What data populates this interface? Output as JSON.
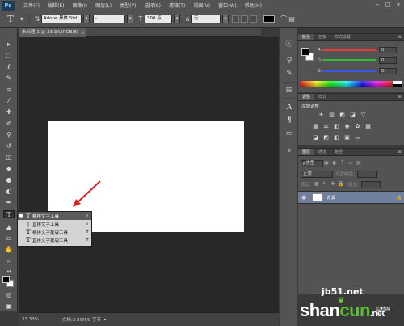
{
  "app": {
    "logo": "Ps",
    "menu": [
      "文件(F)",
      "编辑(E)",
      "图像(I)",
      "图层(L)",
      "类型(Y)",
      "选择(S)",
      "滤镜(T)",
      "视图(V)",
      "窗口(W)",
      "帮助(H)"
    ]
  },
  "options": {
    "font_family": "Adobe 黑体 Std",
    "font_style": "-",
    "font_size": "300 点",
    "antialias": "无"
  },
  "document": {
    "tab_label": "未标题-1 @ 33.3%(RGB/8)",
    "close": "×"
  },
  "flyout": {
    "items": [
      {
        "label": "横排文字工具",
        "key": "T"
      },
      {
        "label": "直排文字工具",
        "key": "T"
      },
      {
        "label": "横排文字蒙版工具",
        "key": "T"
      },
      {
        "label": "直排文字蒙版工具",
        "key": "T"
      }
    ]
  },
  "status": {
    "zoom": "33.33%",
    "doc_info": "文档:3.80M/0 字节"
  },
  "color_panel": {
    "tabs": [
      "颜色",
      "色板",
      "样式设置"
    ],
    "sliders": [
      {
        "label": "R",
        "value": "0",
        "color": "#e83a3a"
      },
      {
        "label": "G",
        "value": "0",
        "color": "#2fbf3a"
      },
      {
        "label": "B",
        "value": "0",
        "color": "#3a55e8"
      }
    ]
  },
  "adjustments": {
    "tabs": [
      "调整",
      "样式"
    ],
    "title": "添加调整"
  },
  "layers": {
    "tabs": [
      "图层",
      "通道",
      "路径"
    ],
    "filter": "ρ类型",
    "blend_mode": "正常",
    "opacity_label": "不透明度:",
    "lock_label": "锁定:",
    "fill_label": "填充:",
    "layer_name": "背景"
  },
  "watermark": {
    "site": "jb51.net",
    "brand_a": "shan",
    "brand_b": "cun",
    "brand_c": ".net",
    "tag": "山村网"
  }
}
